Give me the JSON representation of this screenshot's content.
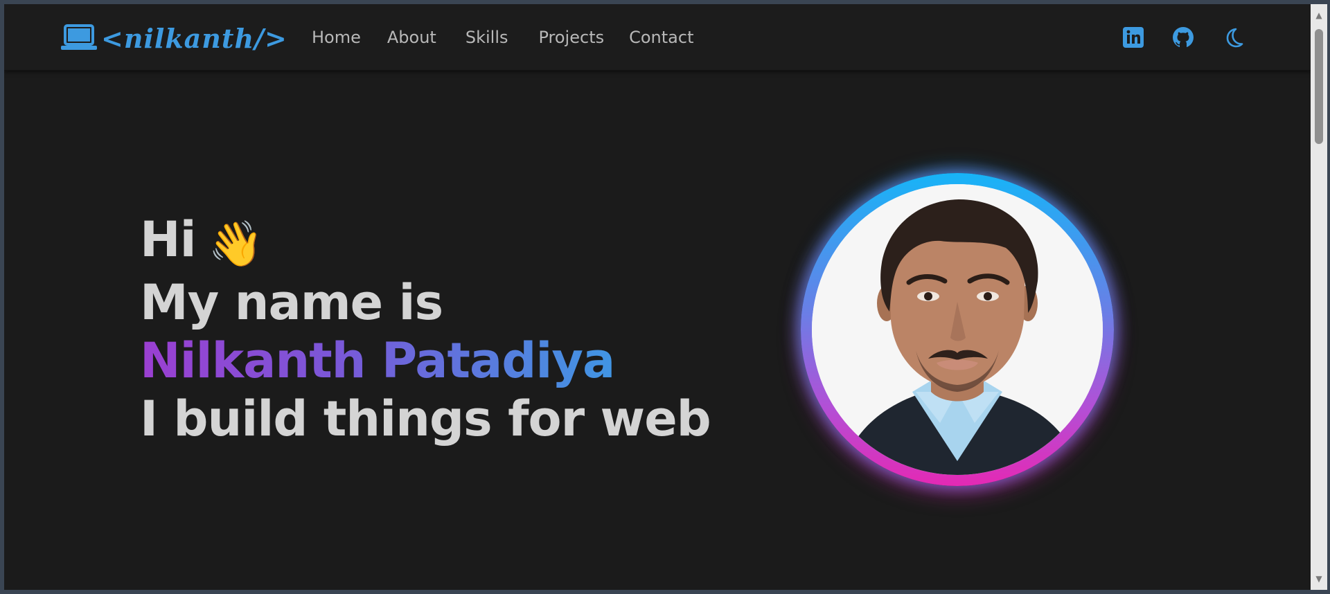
{
  "brand": {
    "text": "<nilkanth/>",
    "icon": "laptop-icon",
    "color": "#3d9ae0"
  },
  "nav": {
    "links": [
      {
        "label": "Home"
      },
      {
        "label": "About"
      },
      {
        "label": "Skills"
      },
      {
        "label": "Projects"
      },
      {
        "label": "Contact"
      }
    ],
    "icons": [
      "linkedin-icon",
      "github-icon",
      "moon-icon"
    ]
  },
  "hero": {
    "greeting": "Hi",
    "wave": "👋",
    "line2": "My name is",
    "name": "Nilkanth Patadiya",
    "line4": "I build things for web",
    "name_gradient": [
      "#9b3fd1",
      "#2fa9e8"
    ]
  },
  "avatar": {
    "ring_colors": [
      "#17b4f7",
      "#e429b4"
    ]
  },
  "theme": {
    "background": "#1b1b1b",
    "accent": "#3d9ae0",
    "text": "#d4d4d4"
  }
}
